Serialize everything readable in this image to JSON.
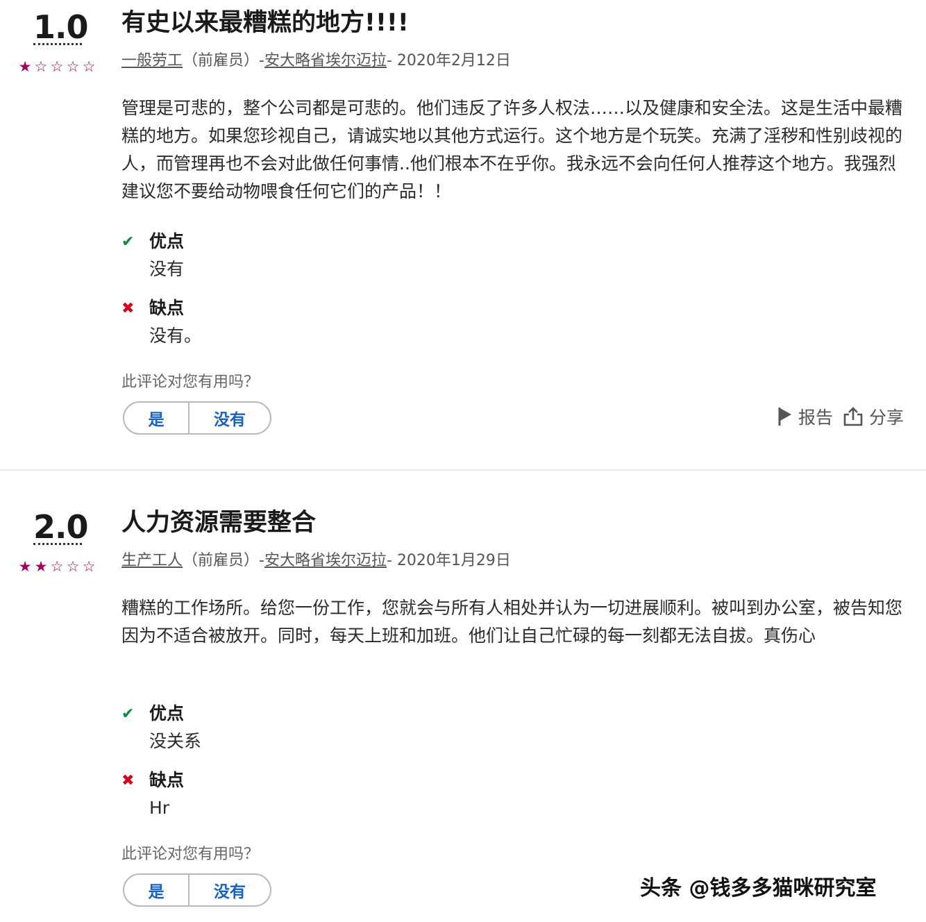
{
  "reviews": [
    {
      "score": "1.0",
      "stars_filled": 1,
      "stars_total": 5,
      "title": "有史以来最糟糕的地方!!!!",
      "job_title": "一般劳工",
      "status": "（前雇员）-",
      "location": "安大略省埃尔迈拉",
      "date": "- 2020年2月12日",
      "body": "管理是可悲的，整个公司都是可悲的。他们违反了许多人权法……以及健康和安全法。这是生活中最糟糕的地方。如果您珍视自己，请诚实地以其他方式运行。这个地方是个玩笑。充满了淫秽和性别歧视的人，而管理再也不会对此做任何事情..他们根本不在乎你。我永远不会向任何人推荐这个地方。我强烈建议您不要给动物喂食任何它们的产品！！",
      "pros_label": "优点",
      "pros": "没有",
      "cons_label": "缺点",
      "cons": "没有。",
      "helpful_question": "此评论对您有用吗？",
      "yes_label": "是",
      "no_label": "没有",
      "report_label": "报告",
      "share_label": "分享"
    },
    {
      "score": "2.0",
      "stars_filled": 2,
      "stars_total": 5,
      "title": "人力资源需要整合",
      "job_title": "生产工人",
      "status": "（前雇员）-",
      "location": "安大略省埃尔迈拉",
      "date": "- 2020年1月29日",
      "body": "糟糕的工作场所。给您一份工作，您就会与所有人相处并认为一切进展顺利。被叫到办公室，被告知您因为不适合被放开。同时，每天上班和加班。他们让自己忙碌的每一刻都无法自拔。真伤心",
      "pros_label": "优点",
      "pros": "没关系",
      "cons_label": "缺点",
      "cons": "Hr",
      "helpful_question": "此评论对您有用吗？",
      "yes_label": "是",
      "no_label": "没有"
    }
  ],
  "icons": {
    "pros": "check-icon",
    "cons": "cross-icon",
    "star_filled": "★",
    "star_empty": "☆",
    "report": "flag-icon",
    "share": "share-icon"
  },
  "colors": {
    "star": "#a3005f",
    "pros": "#0c8a3a",
    "cons": "#d8001c",
    "button_text": "#1861bf"
  },
  "watermark": "头条 @钱多多猫咪研究室"
}
